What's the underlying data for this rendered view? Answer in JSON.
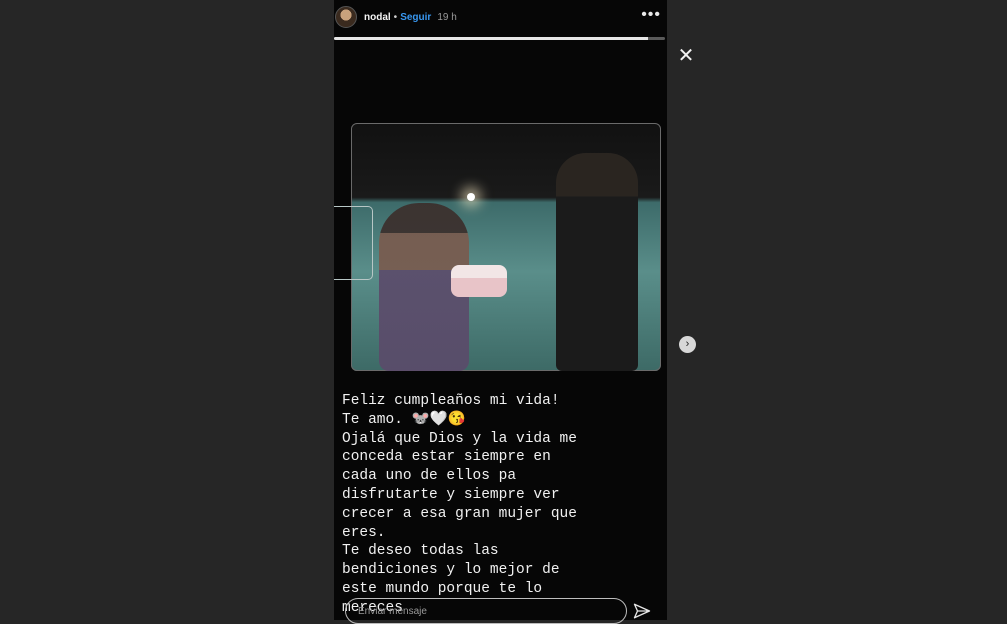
{
  "story": {
    "username": "nodal",
    "separator": "•",
    "follow_label": "Seguir",
    "time_ago": "19 h",
    "more_label": "•••",
    "progress_fraction": 0.95,
    "caption": "Feliz cumpleaños mi vida!\nTe amo. 🐭🤍😘\nOjalá que Dios y la vida me\nconceda estar siempre en\ncada uno de ellos pa\ndisfrutarte y siempre ver\ncrecer a esa gran mujer que\neres.\nTe deseo todas las\nbendiciones y lo mejor de\neste mundo porque te lo\nmereces"
  },
  "controls": {
    "close_label": "✕",
    "next_label": "›"
  },
  "reply": {
    "placeholder": "Enviar mensaje"
  },
  "colors": {
    "follow": "#3897f0",
    "background": "#262626"
  },
  "icons": [
    "avatar",
    "more-options-icon",
    "close-icon",
    "next-arrow-icon",
    "send-icon"
  ]
}
